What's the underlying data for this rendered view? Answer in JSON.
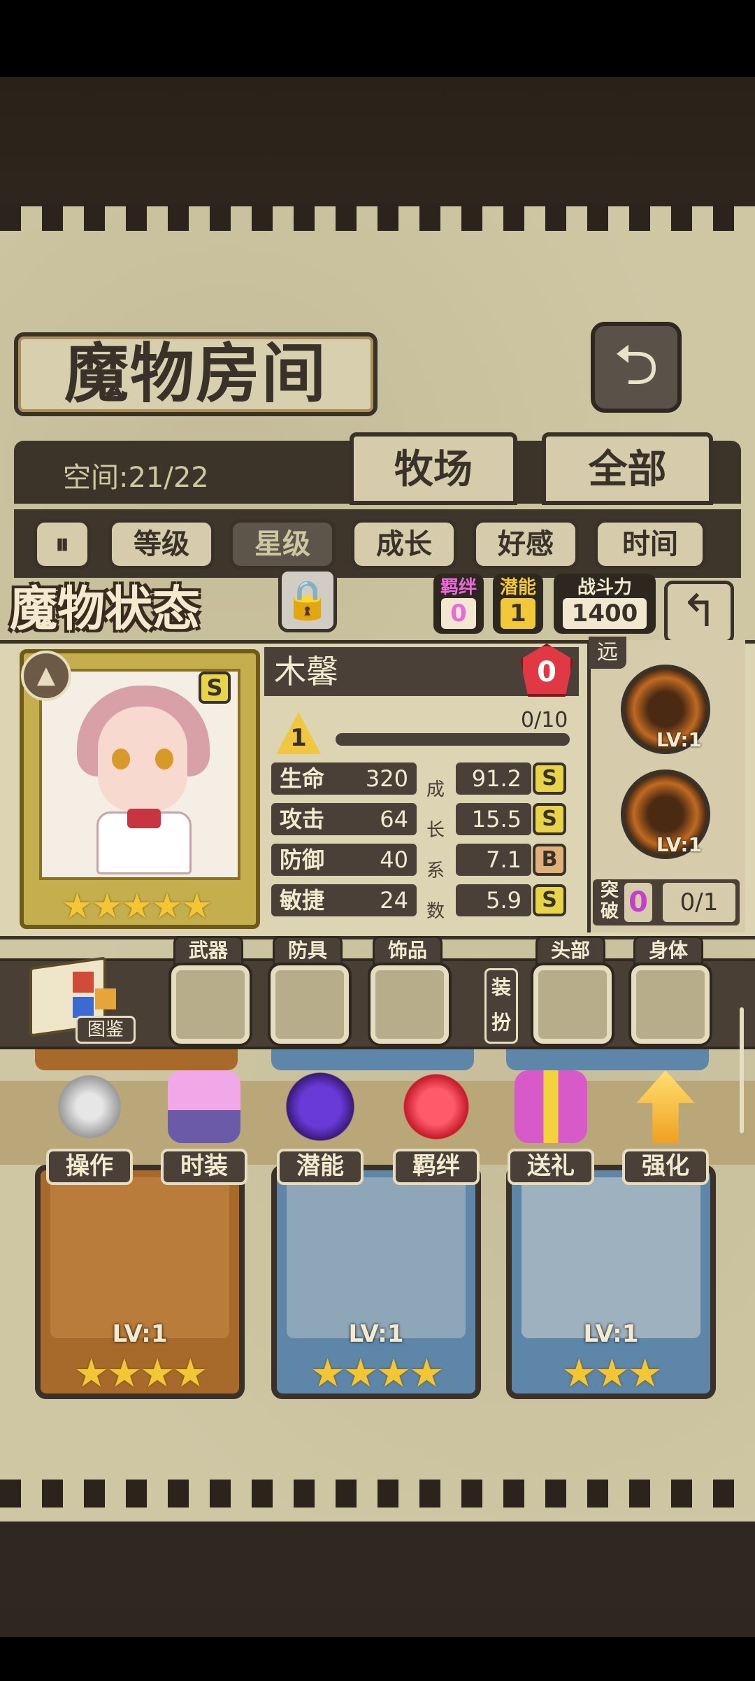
{
  "title": "魔物房间",
  "back_icon": "back-arrow-icon",
  "space_label": "空间:21/22",
  "tabs": [
    "牧场",
    "全部"
  ],
  "sort_buttons": [
    "等级",
    "星级",
    "成长",
    "好感",
    "时间"
  ],
  "status_title": "魔物状态",
  "stats_boxes": {
    "bond_label": "羁绊",
    "bond_value": "0",
    "potential_label": "潜能",
    "potential_value": "1",
    "power_label": "战斗力",
    "power_value": "1400"
  },
  "monster": {
    "name": "木馨",
    "affection": "0",
    "rank": "S",
    "stars": 5,
    "stars_display": "★★★★★",
    "level": "1",
    "xp": "0/10",
    "xp_fraction": 0,
    "stats": [
      {
        "label": "生命",
        "value": "320",
        "growth": "91.2",
        "grade": "S"
      },
      {
        "label": "攻击",
        "value": "64",
        "growth": "15.5",
        "grade": "S"
      },
      {
        "label": "防御",
        "value": "40",
        "growth": "7.1",
        "grade": "B"
      },
      {
        "label": "敏捷",
        "value": "24",
        "growth": "5.9",
        "grade": "S"
      }
    ],
    "growth_vertical": [
      "成",
      "长",
      "系",
      "数"
    ],
    "range": "远",
    "skills": [
      {
        "level": "LV:1"
      },
      {
        "level": "LV:1"
      }
    ],
    "breakthrough_label": "突破",
    "breakthrough_value": "0",
    "breakthrough_count": "0/1"
  },
  "equipment": {
    "book_label": "图鉴",
    "slots": [
      "武器",
      "防具",
      "饰品",
      "头部",
      "身体"
    ],
    "dress_label": "装扮"
  },
  "actions": [
    "操作",
    "时装",
    "潜能",
    "羁绊",
    "送礼",
    "强化"
  ],
  "cards": [
    {
      "level": "LV:1",
      "stars": "★★★★",
      "frame": "#a86a2a",
      "bg": "#b97c3a"
    },
    {
      "level": "LV:1",
      "stars": "★★★★",
      "frame": "#5e86a8",
      "bg": "#8ea7b8"
    },
    {
      "level": "LV:1",
      "stars": "★★★",
      "frame": "#5e86a8",
      "bg": "#9db1bf"
    }
  ],
  "colors": {
    "board": "#cfc7a4",
    "dark": "#3a3128",
    "gem": "#e13845",
    "grade_S": "#e8d44a",
    "grade_B": "#e0b07a"
  }
}
